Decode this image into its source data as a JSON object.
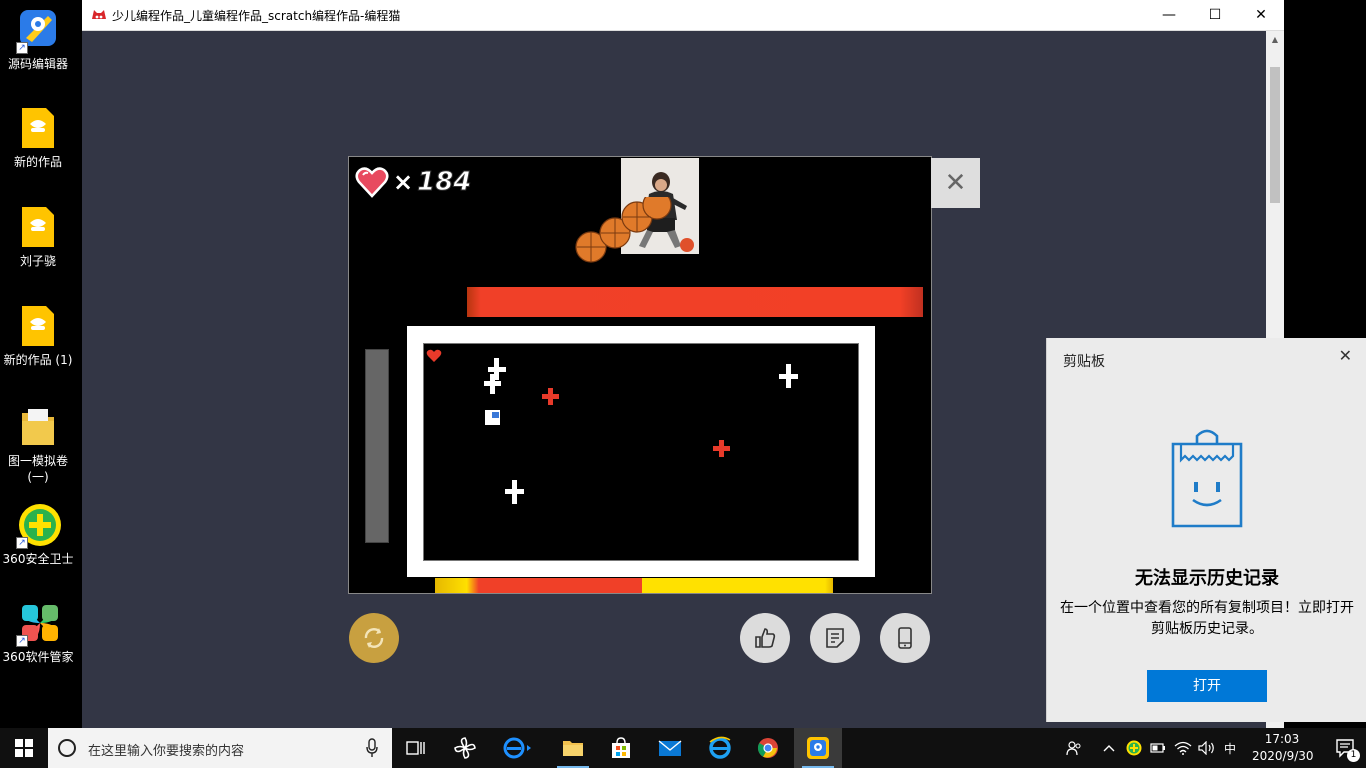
{
  "desktop": {
    "icons": [
      {
        "label": "源码编辑器",
        "icon": "code-editor-icon"
      },
      {
        "label": "新的作品",
        "icon": "codemao-file-icon"
      },
      {
        "label": "刘子骁",
        "icon": "codemao-file-icon"
      },
      {
        "label": "新的作品 (1)",
        "icon": "codemao-file-icon"
      },
      {
        "label": "图一模拟卷\n(一)",
        "icon": "folder-icon"
      },
      {
        "label": "360安全卫士",
        "icon": "360-safe-icon"
      },
      {
        "label": "360软件管家",
        "icon": "360-software-icon"
      }
    ]
  },
  "window": {
    "title": "少儿编程作品_儿童编程作品_scratch编程作品-编程猫",
    "minimize": "—",
    "maximize": "☐",
    "close": "✕"
  },
  "game": {
    "lives_symbol": "×",
    "lives_count": "184",
    "hp_bar_fill": 1.0,
    "stage_close": "✕"
  },
  "clipboard": {
    "title": "剪贴板",
    "close": "✕",
    "heading": "无法显示历史记录",
    "description": "在一个位置中查看您的所有复制项目！立即打开剪贴板历史记录。",
    "open_button": "打开"
  },
  "taskbar": {
    "search_placeholder": "在这里输入你要搜索的内容",
    "ime": "中",
    "time": "17:03",
    "date": "2020/9/30",
    "notification_count": "1"
  },
  "colors": {
    "window_bg": "#333645",
    "hp_red": "#f24026",
    "accent_blue": "#0078d7",
    "replay_gold": "#c8a040"
  }
}
